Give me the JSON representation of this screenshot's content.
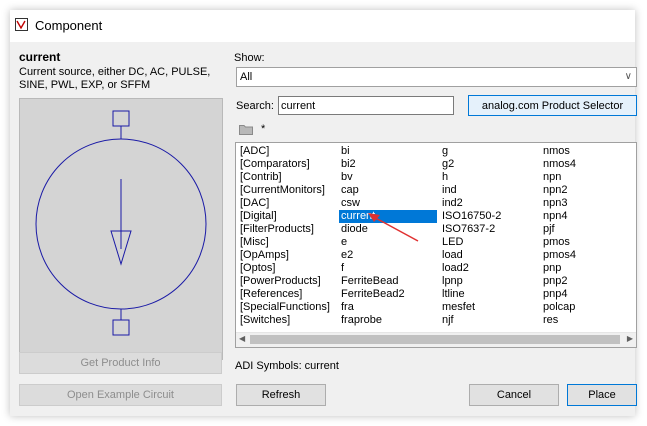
{
  "window": {
    "title": "Component"
  },
  "component": {
    "name": "current",
    "description": "Current source, either DC, AC, PULSE, SINE, PWL, EXP, or SFFM"
  },
  "buttons": {
    "get_product_info": "Get Product Info",
    "open_example": "Open Example Circuit",
    "refresh": "Refresh",
    "cancel": "Cancel",
    "place": "Place",
    "analog_selector": "analog.com Product Selector"
  },
  "show": {
    "label": "Show:",
    "value": "All"
  },
  "search": {
    "label": "Search:",
    "value": "current"
  },
  "path": {
    "star": "*"
  },
  "list": {
    "columns": [
      [
        "[ADC]",
        "[Comparators]",
        "[Contrib]",
        "[CurrentMonitors]",
        "[DAC]",
        "[Digital]",
        "[FilterProducts]",
        "[Misc]",
        "[OpAmps]",
        "[Optos]",
        "[PowerProducts]",
        "[References]",
        "[SpecialFunctions]",
        "[Switches]"
      ],
      [
        "bi",
        "bi2",
        "bv",
        "cap",
        "csw",
        "current",
        "diode",
        "e",
        "e2",
        "f",
        "FerriteBead",
        "FerriteBead2",
        "fra",
        "fraprobe"
      ],
      [
        "g",
        "g2",
        "h",
        "ind",
        "ind2",
        "ISO16750-2",
        "ISO7637-2",
        "LED",
        "load",
        "load2",
        "lpnp",
        "ltline",
        "mesfet",
        "njf"
      ],
      [
        "nmos",
        "nmos4",
        "npn",
        "npn2",
        "npn3",
        "npn4",
        "pjf",
        "pmos",
        "pmos4",
        "pnp",
        "pnp2",
        "pnp4",
        "polcap",
        "res"
      ]
    ],
    "selected": "current"
  },
  "status": {
    "text": "ADI Symbols: current"
  },
  "icons": {
    "app": "ltspice-app-icon",
    "folder": "folder-icon",
    "dropdown": "chevron-down-icon",
    "pointer": "red-arrow-pointer"
  },
  "colors": {
    "selection": "#0078d7",
    "symbol_stroke": "#1a1aa6",
    "pointer": "#e03030",
    "preview_bg": "#d4d4d4"
  }
}
